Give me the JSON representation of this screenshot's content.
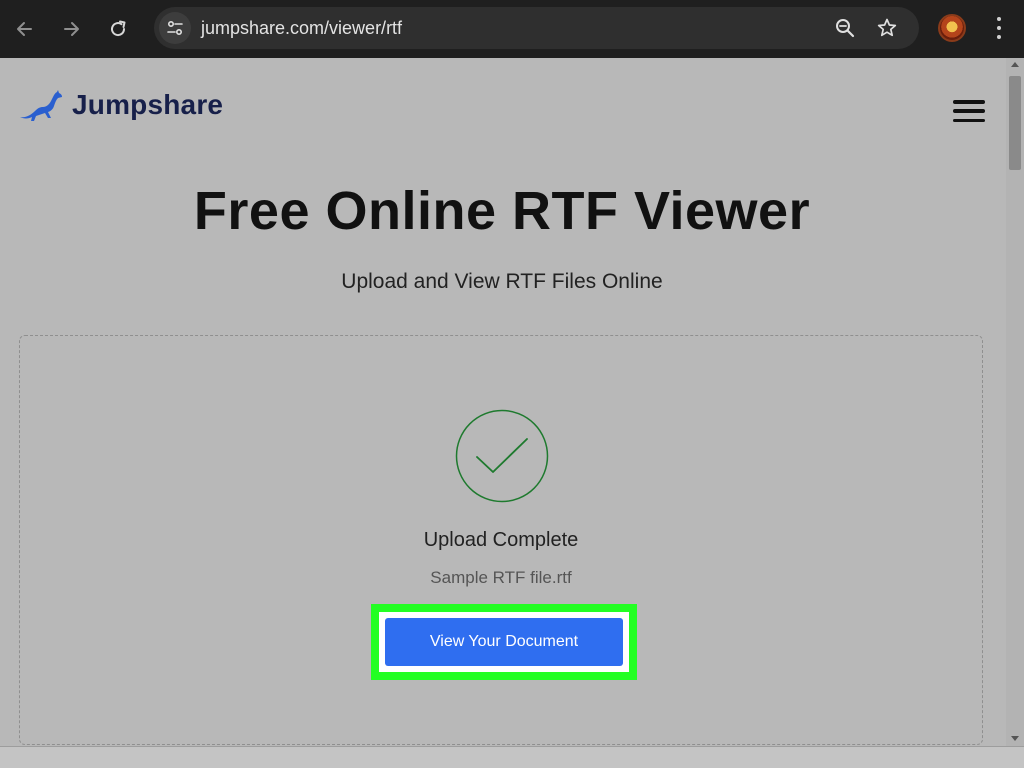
{
  "browser": {
    "url": "jumpshare.com/viewer/rtf"
  },
  "site": {
    "logo_text": "Jumpshare"
  },
  "hero": {
    "title": "Free Online RTF Viewer",
    "subtitle": "Upload and View RTF Files Online"
  },
  "upload": {
    "status": "Upload Complete",
    "file_name": "Sample RTF file.rtf",
    "button_label": "View Your Document"
  },
  "colors": {
    "brand_navy": "#17204a",
    "brand_blue": "#2f6ef0",
    "success_green": "#1e7a2e",
    "highlight_green": "#23ff23"
  },
  "icons": {
    "back": "arrow-left-icon",
    "forward": "arrow-right-icon",
    "reload": "reload-icon",
    "site_info": "tune-icon",
    "zoom": "zoom-icon",
    "bookmark": "star-icon",
    "menu": "more-vertical-icon",
    "site_menu": "hamburger-icon",
    "logo": "kangaroo-icon",
    "status": "check-circle-icon"
  }
}
